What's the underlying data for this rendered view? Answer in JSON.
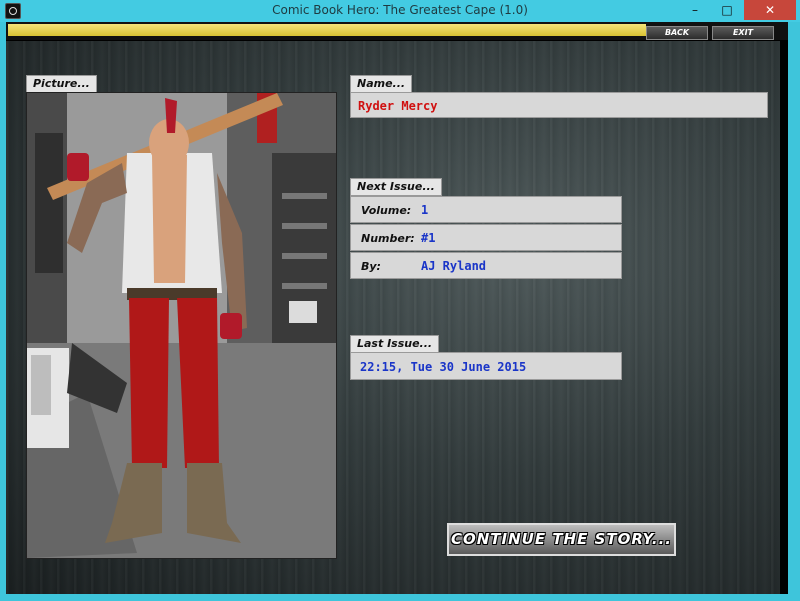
{
  "window": {
    "title": "Comic Book Hero: The Greatest Cape (1.0)",
    "minimize_glyph": "–",
    "maximize_glyph": "□",
    "close_glyph": "✕"
  },
  "nav": {
    "back_label": "BACK",
    "exit_label": "EXIT"
  },
  "picture": {
    "tab_label": "Picture..."
  },
  "name": {
    "tab_label": "Name...",
    "value": "Ryder Mercy",
    "color": "#d01010"
  },
  "next_issue": {
    "tab_label": "Next Issue...",
    "rows": [
      {
        "key": "Volume:",
        "value": "1"
      },
      {
        "key": "Number:",
        "value": "#1"
      },
      {
        "key": "By:",
        "value": "AJ Ryland"
      }
    ]
  },
  "last_issue": {
    "tab_label": "Last Issue...",
    "value": "22:15, Tue 30 June 2015"
  },
  "continue": {
    "label": "CONTINUE THE STORY..."
  },
  "colors": {
    "value_blue": "#1a35c8",
    "accent_yellow": "#e8d34f",
    "titlebar": "#43cbe2"
  },
  "icons": {
    "app": "comic-app-icon",
    "picture": "hero-portrait-image"
  }
}
